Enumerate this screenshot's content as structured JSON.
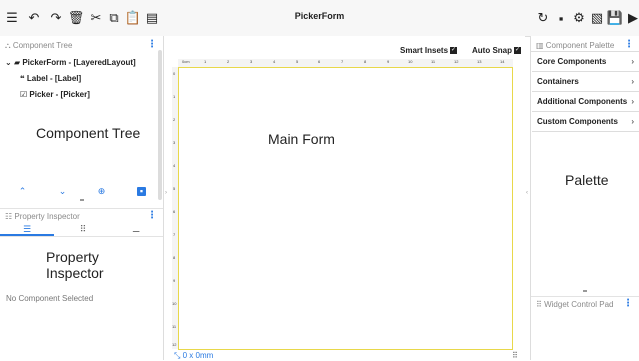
{
  "app": {
    "title": "PickerForm"
  },
  "toolbar": {
    "left_icons": [
      "menu-icon",
      "undo-icon",
      "redo-icon",
      "delete-icon",
      "cut-icon",
      "copy-icon",
      "paste-icon",
      "form-icon"
    ],
    "right_icons": [
      "refresh-icon",
      "save-icon",
      "settings-icon",
      "image-icon",
      "disk-icon",
      "play-icon"
    ]
  },
  "component_tree": {
    "header": "Component Tree",
    "items": [
      {
        "label": "PickerForm - [LayeredLayout]"
      },
      {
        "label": "Label - [Label]"
      },
      {
        "label": "Picker - [Picker]"
      }
    ],
    "overlay_label": "Component Tree"
  },
  "property_inspector": {
    "header": "Property Inspector",
    "overlay_label": "Property Inspector",
    "empty_text": "No Component Selected"
  },
  "main": {
    "overlay_label": "Main Form",
    "smart_insets_label": "Smart Insets",
    "auto_snap_label": "Auto Snap",
    "ruler_top": [
      "0cm",
      "1",
      "2",
      "3",
      "4",
      "5",
      "6",
      "7",
      "8",
      "9",
      "10",
      "11",
      "12",
      "13",
      "14"
    ],
    "ruler_left": [
      "0",
      "1",
      "2",
      "3",
      "4",
      "5",
      "6",
      "7",
      "8",
      "9",
      "10",
      "11",
      "12"
    ],
    "size_readout": "0 x 0mm"
  },
  "palette": {
    "header": "Component Palette",
    "items": [
      {
        "label": "Core Components"
      },
      {
        "label": "Containers"
      },
      {
        "label": "Additional Components"
      },
      {
        "label": "Custom Components"
      }
    ],
    "overlay_label": "Palette",
    "widget_pad_header": "Widget Control Pad"
  }
}
